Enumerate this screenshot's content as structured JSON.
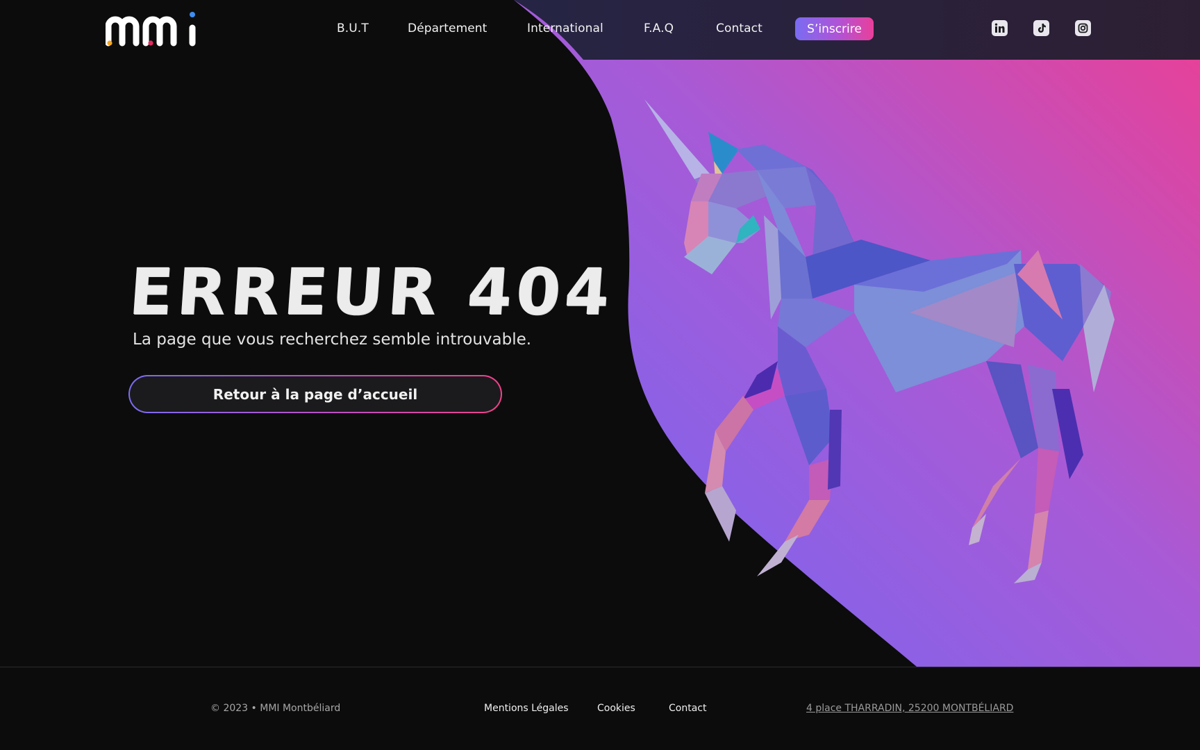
{
  "header": {
    "logo_alt": "mmi",
    "nav": [
      {
        "label": "B.U.T"
      },
      {
        "label": "Département"
      },
      {
        "label": "International"
      },
      {
        "label": "F.A.Q"
      },
      {
        "label": "Contact"
      }
    ],
    "cta_label": "S’inscrire",
    "social": [
      {
        "name": "linkedin-icon"
      },
      {
        "name": "tiktok-icon"
      },
      {
        "name": "instagram-icon"
      }
    ]
  },
  "hero": {
    "title": "ERREUR 404",
    "subtitle": "La page que vous recherchez semble introuvable.",
    "button_label": "Retour à la page d’accueil"
  },
  "footer": {
    "copyright": "© 2023  •  MMI Montbéliard",
    "links": [
      "Mentions Légales",
      "Cookies",
      "Contact"
    ],
    "address": "4 place THARRADIN, 25200 MONTBÉLIARD"
  },
  "colors": {
    "background": "#0c0c0c",
    "gradient_start": "#7b6cf6",
    "gradient_end": "#e83e96",
    "header_tint": "#2a2340"
  }
}
